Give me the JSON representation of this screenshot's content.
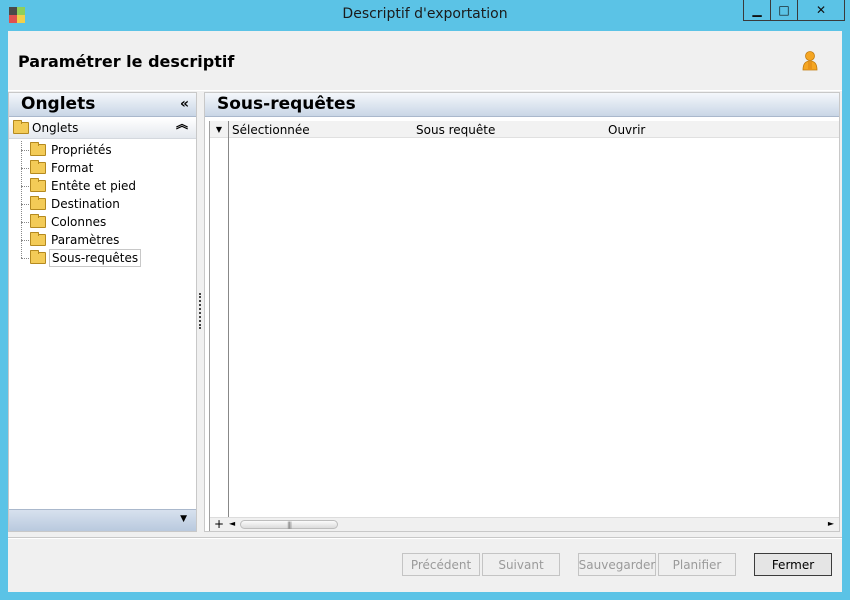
{
  "window": {
    "title": "Descriptif d'exportation",
    "min_label": "▁",
    "max_label": "□",
    "close_label": "✕"
  },
  "header": {
    "title": "Paramétrer le descriptif"
  },
  "left_panel": {
    "title": "Onglets",
    "collapse_glyph": "«",
    "group": {
      "label": "Onglets",
      "toggle_glyph": "︽"
    },
    "items": [
      {
        "label": "Propriétés"
      },
      {
        "label": "Format"
      },
      {
        "label": "Entête et pied"
      },
      {
        "label": "Destination"
      },
      {
        "label": "Colonnes"
      },
      {
        "label": "Paramètres"
      },
      {
        "label": "Sous-requêtes",
        "selected": true
      }
    ],
    "footer_glyph": "▼"
  },
  "right_panel": {
    "title": "Sous-requêtes",
    "grid": {
      "corner_glyph": "▼",
      "columns": [
        "Sélectionnée",
        "Sous requête",
        "Ouvrir"
      ],
      "add_row_glyph": "+",
      "scroll_left_glyph": "◄",
      "scroll_right_glyph": "►",
      "thumb_grip": "|||"
    }
  },
  "footer": {
    "prev_label": "Précédent",
    "next_label": "Suivant",
    "save_label": "Sauvegarder",
    "plan_label": "Planifier",
    "close_label": "Fermer"
  },
  "colors": {
    "window_frame": "#5bc3e6",
    "panel_header": "#c9d6e6",
    "folder": "#f3cb57"
  }
}
